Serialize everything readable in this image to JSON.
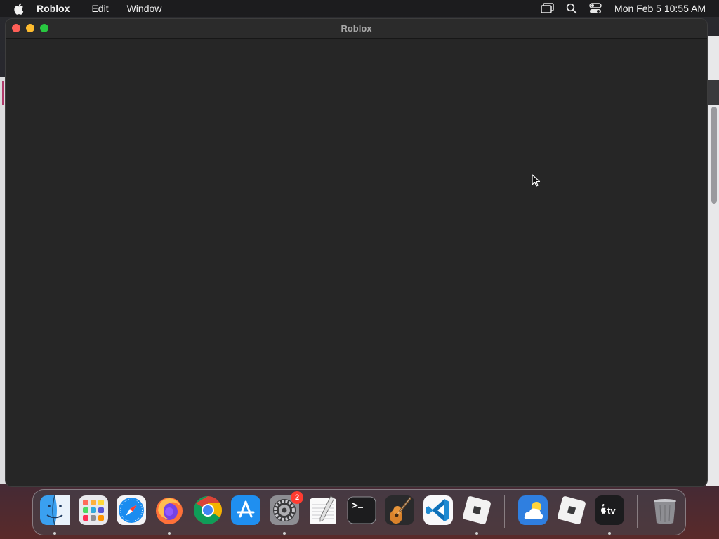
{
  "menubar": {
    "app_name": "Roblox",
    "menus": [
      "Edit",
      "Window"
    ],
    "clock": "Mon Feb 5  10:55 AM",
    "status_icons": [
      "screen-mirroring-icon",
      "search-icon",
      "control-center-icon"
    ]
  },
  "window": {
    "title": "Roblox"
  },
  "dock": {
    "apps": [
      {
        "name": "Finder",
        "icon": "finder-icon",
        "running": true
      },
      {
        "name": "Launchpad",
        "icon": "launchpad-icon",
        "running": false
      },
      {
        "name": "Safari",
        "icon": "safari-icon",
        "running": false
      },
      {
        "name": "Firefox",
        "icon": "firefox-icon",
        "running": true
      },
      {
        "name": "Google Chrome",
        "icon": "chrome-icon",
        "running": false
      },
      {
        "name": "App Store",
        "icon": "app-store-icon",
        "running": false
      },
      {
        "name": "System Settings",
        "icon": "system-settings-icon",
        "running": true,
        "badge": "2"
      },
      {
        "name": "TextEdit",
        "icon": "textedit-icon",
        "running": false
      },
      {
        "name": "Terminal",
        "icon": "terminal-icon",
        "running": false
      },
      {
        "name": "GarageBand",
        "icon": "garageband-icon",
        "running": false
      },
      {
        "name": "Visual Studio Code",
        "icon": "vscode-icon",
        "running": false
      },
      {
        "name": "Roblox",
        "icon": "roblox-icon",
        "running": true
      },
      {
        "name": "Weather",
        "icon": "weather-icon",
        "running": false
      },
      {
        "name": "Roblox Studio",
        "icon": "roblox-studio-icon",
        "running": false
      },
      {
        "name": "Apple TV",
        "icon": "apple-tv-icon",
        "running": true
      },
      {
        "name": "Trash",
        "icon": "trash-icon",
        "running": false
      }
    ],
    "system_settings_badge": "2"
  },
  "colors": {
    "menubar_bg": "#1c1c1e",
    "window_bg": "#262626",
    "close": "#ff5f57",
    "minimize": "#febc2e",
    "maximize": "#28c840",
    "badge": "#ff3b30"
  }
}
